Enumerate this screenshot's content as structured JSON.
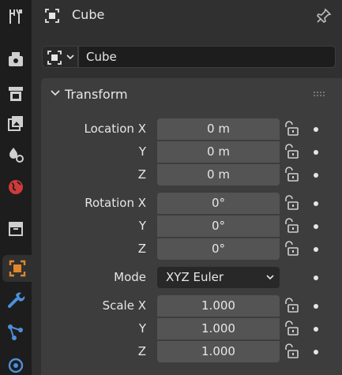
{
  "header": {
    "object_name": "Cube"
  },
  "name_field": {
    "value": "Cube"
  },
  "panel": {
    "title": "Transform",
    "location": [
      {
        "label": "Location X",
        "value": "0 m"
      },
      {
        "label": "Y",
        "value": "0 m"
      },
      {
        "label": "Z",
        "value": "0 m"
      }
    ],
    "rotation": [
      {
        "label": "Rotation X",
        "value": "0°"
      },
      {
        "label": "Y",
        "value": "0°"
      },
      {
        "label": "Z",
        "value": "0°"
      }
    ],
    "mode": {
      "label": "Mode",
      "value": "XYZ Euler"
    },
    "scale": [
      {
        "label": "Scale X",
        "value": "1.000"
      },
      {
        "label": "Y",
        "value": "1.000"
      },
      {
        "label": "Z",
        "value": "1.000"
      }
    ]
  },
  "sidebar": {
    "tabs": [
      {
        "icon": "tool-icon"
      },
      {
        "icon": "render-icon"
      },
      {
        "icon": "output-icon"
      },
      {
        "icon": "view-layer-icon"
      },
      {
        "icon": "scene-icon"
      },
      {
        "icon": "world-icon"
      },
      {
        "icon": "collection-icon"
      },
      {
        "icon": "object-icon",
        "active": true
      },
      {
        "icon": "modifier-icon"
      },
      {
        "icon": "particles-icon"
      },
      {
        "icon": "physics-icon"
      }
    ]
  },
  "colors": {
    "sidebar_bg": "#1d1d1d",
    "editor_bg": "#303030",
    "panel_bg": "#3d3d3d",
    "field_bg": "#545454",
    "object_orange": "#e0862b",
    "modifier_blue": "#4d8fdc",
    "world_red": "#d03a3a"
  }
}
